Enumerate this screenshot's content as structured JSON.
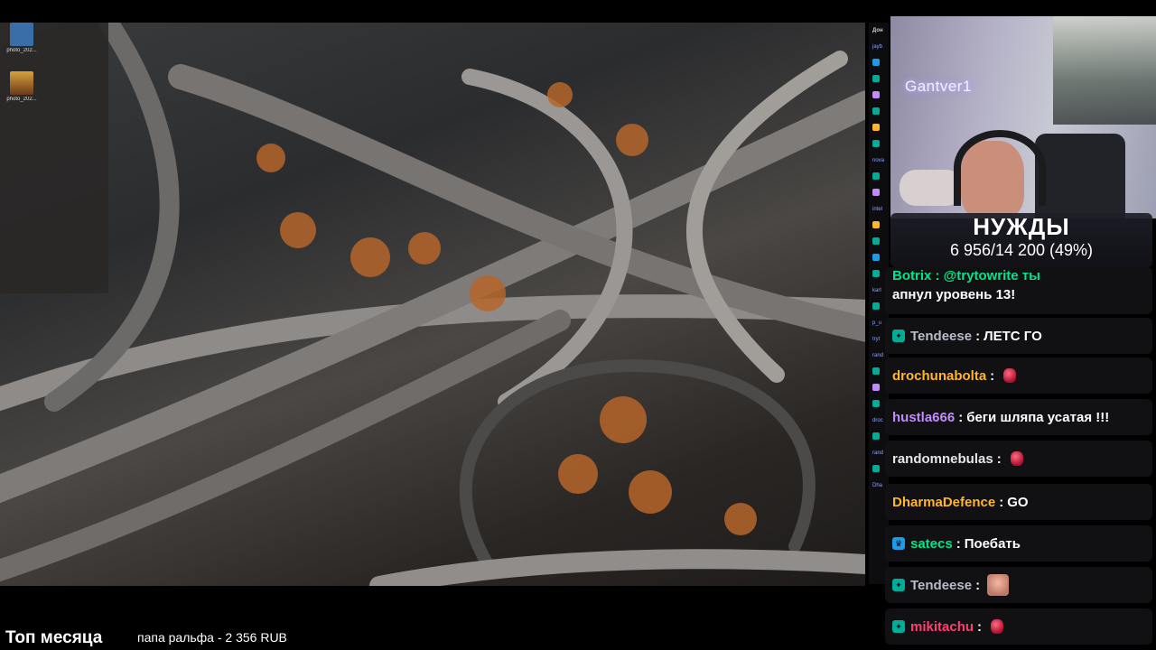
{
  "colors": {
    "chat_bg": "#121216",
    "twitch_green": "#00ad96",
    "twitch_purple": "#9146ff"
  },
  "desktop": {
    "icons": [
      {
        "label": "photo_202...",
        "icon": "image-file-icon"
      },
      {
        "label": "photo_202...",
        "icon": "image-file-icon"
      }
    ]
  },
  "webcam": {
    "neon_sign": "Gantver1"
  },
  "goal": {
    "title": "НУЖДЫ",
    "progress_text": "6 956/14 200 (49%)",
    "progress_fraction": 0.49
  },
  "chat": {
    "messages": [
      {
        "user": "Botrix",
        "text": "@trytowrite ты апнул уровень 13!",
        "line1": "Botrix : @trytowrite ты",
        "line2": "апнул уровень 13!",
        "user_color": "#00e58a",
        "badge": "twitch-badge-icon"
      },
      {
        "user": "Tendeese",
        "text": "ЛЕТС ГО",
        "user_color": "#b8bcc8",
        "badge": "gift-badge-icon"
      },
      {
        "user": "drochunabolta",
        "text": "",
        "user_color": "#ffb52e",
        "emote": "gem-emote"
      },
      {
        "user": "hustla666",
        "text": "беги шляпа усатая !!!",
        "user_color": "#c28cff"
      },
      {
        "user": "randomnebulas",
        "text": "",
        "user_color": "#e6e6e6",
        "emote": "gem-emote"
      },
      {
        "user": "DharmaDefence",
        "text": "GO",
        "user_color": "#ffb52e"
      },
      {
        "user": "satecs",
        "text": "Поебать",
        "user_color": "#00e58a",
        "badge": "prime-badge-icon"
      },
      {
        "user": "Tendeese",
        "text": "",
        "user_color": "#b8bcc8",
        "badge": "gift-badge-icon",
        "emote": "face-emote"
      },
      {
        "user": "mikitachu",
        "text": "",
        "user_color": "#ff3d6e",
        "badge": "gift-badge-icon",
        "emote": "gem-emote"
      }
    ]
  },
  "mini_chat": {
    "header": "Дон",
    "names": [
      "jayb",
      "",
      "",
      "",
      "",
      "",
      "",
      "nova",
      "",
      "",
      "intel",
      "",
      "",
      "",
      "",
      "karl",
      "",
      "p_u",
      "tryt",
      "rand",
      "",
      "",
      "",
      "droc",
      "",
      "rand",
      "",
      "Dha"
    ]
  },
  "bottom": {
    "top_title": "Топ месяца",
    "top_donor": "папа ральфа - 2 356 RUB"
  }
}
